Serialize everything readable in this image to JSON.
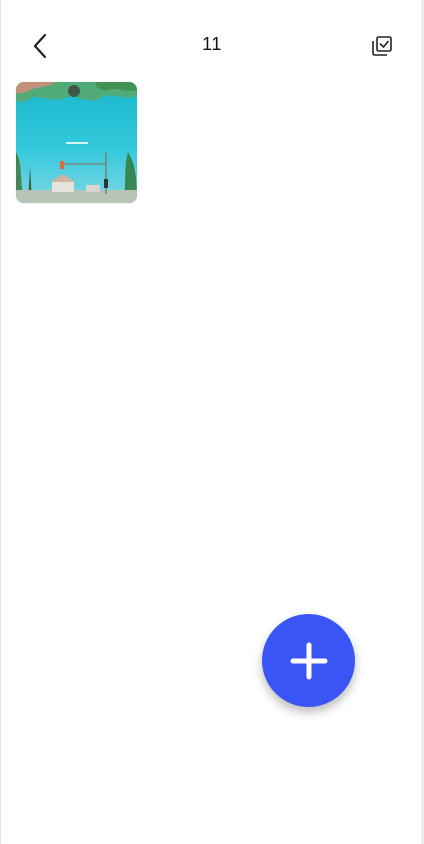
{
  "header": {
    "title": "11",
    "back_icon": "chevron-left-icon",
    "select_icon": "multi-select-icon"
  },
  "gallery": {
    "items": [
      {
        "type": "photo",
        "description_icon": "beach-photo-thumbnail"
      }
    ]
  },
  "fab": {
    "icon": "plus-icon",
    "color": "#3a55f5"
  }
}
